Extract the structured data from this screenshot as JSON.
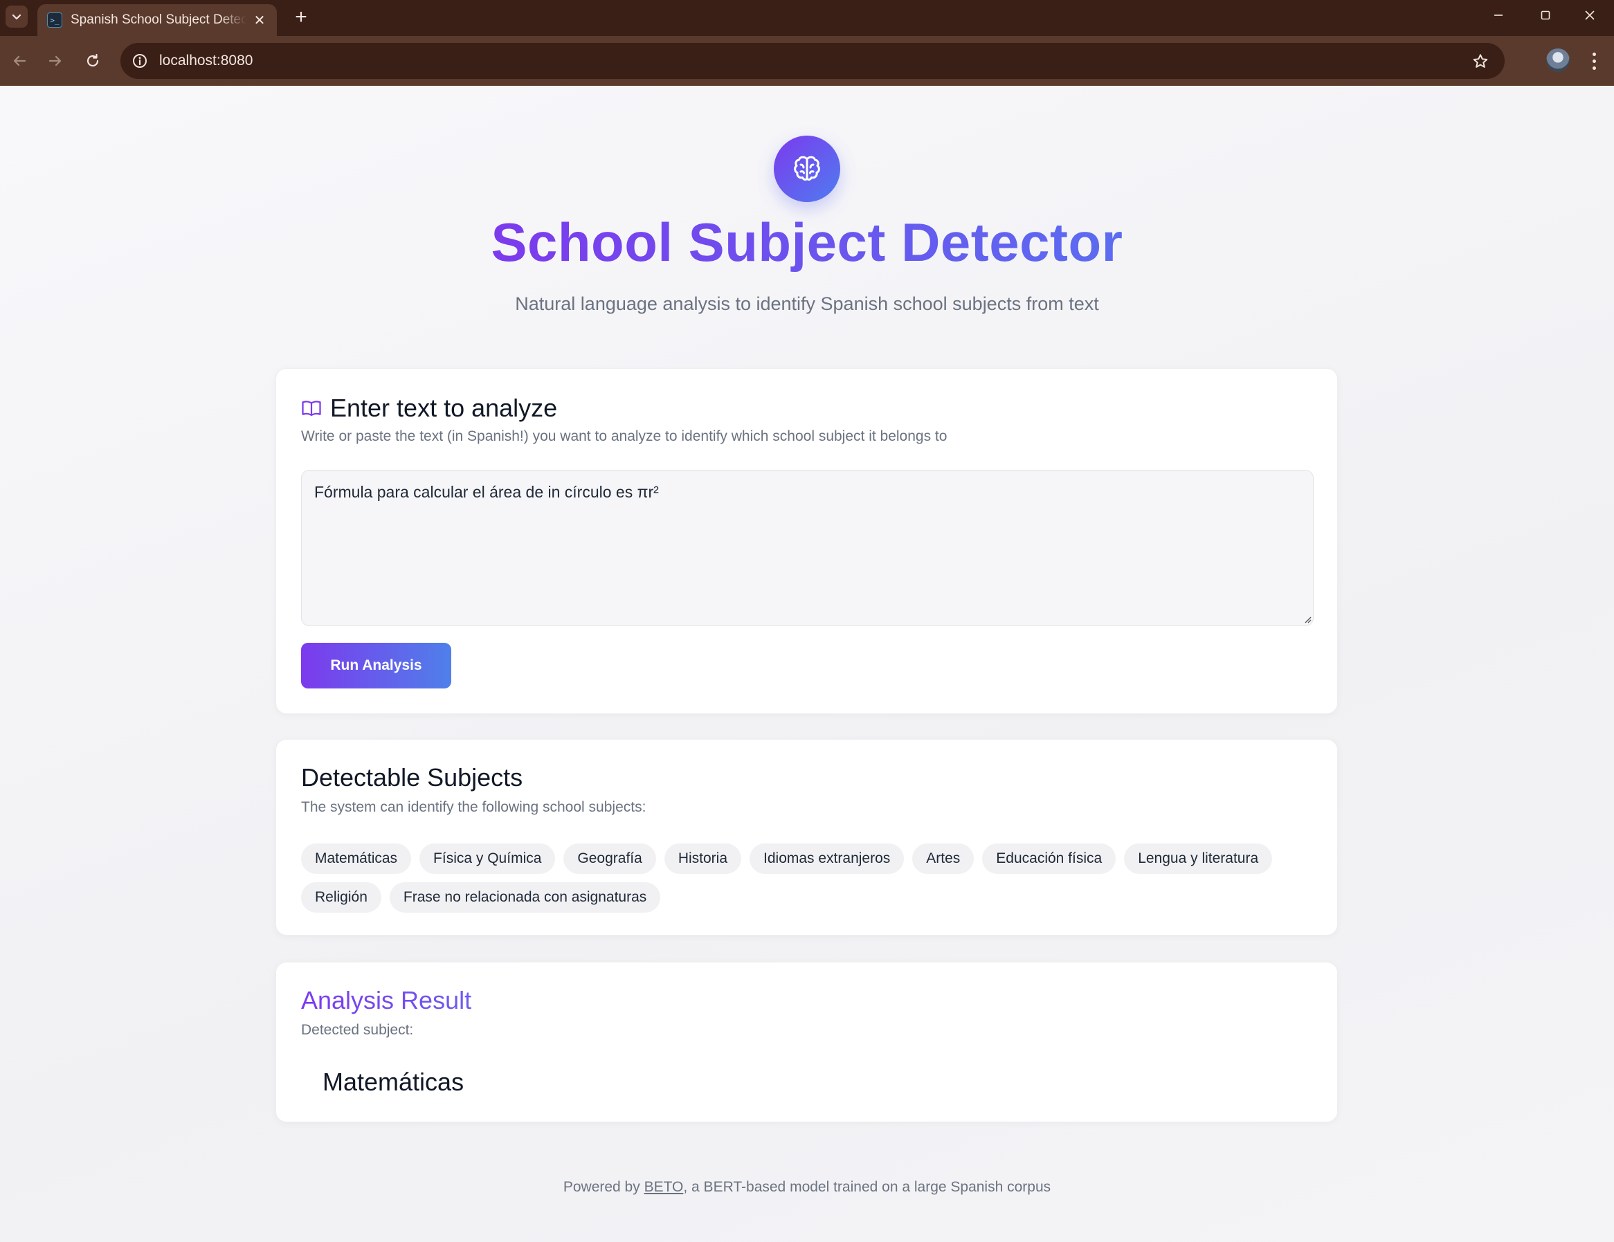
{
  "browser": {
    "tab_title": "Spanish School Subject Detector",
    "new_tab_label": "+",
    "url": "localhost:8080"
  },
  "header": {
    "logo_icon": "brain-icon",
    "title": "School Subject Detector",
    "subtitle": "Natural language analysis to identify Spanish school subjects from text"
  },
  "input_card": {
    "icon": "book-open-icon",
    "title": "Enter text to analyze",
    "description": "Write or paste the text (in Spanish!) you want to analyze to identify which school subject it belongs to",
    "textarea_value": "Fórmula para calcular el área de in círculo es πr²",
    "button_label": "Run Analysis"
  },
  "subjects_card": {
    "title": "Detectable Subjects",
    "description": "The system can identify the following school subjects:",
    "subjects": [
      "Matemáticas",
      "Física y Química",
      "Geografía",
      "Historia",
      "Idiomas extranjeros",
      "Artes",
      "Educación física",
      "Lengua y literatura",
      "Religión",
      "Frase no relacionada con asignaturas"
    ]
  },
  "result_card": {
    "title": "Analysis Result",
    "label": "Detected subject:",
    "value": "Matemáticas"
  },
  "footer": {
    "prefix": "Powered by ",
    "link_text": "BETO",
    "suffix": ", a BERT-based model trained on a large Spanish corpus"
  },
  "colors": {
    "accent_start": "#7c3aed",
    "accent_end": "#4f80ea",
    "chrome_dark": "#3a1f16",
    "chrome_toolbar": "#5a3a2c"
  }
}
